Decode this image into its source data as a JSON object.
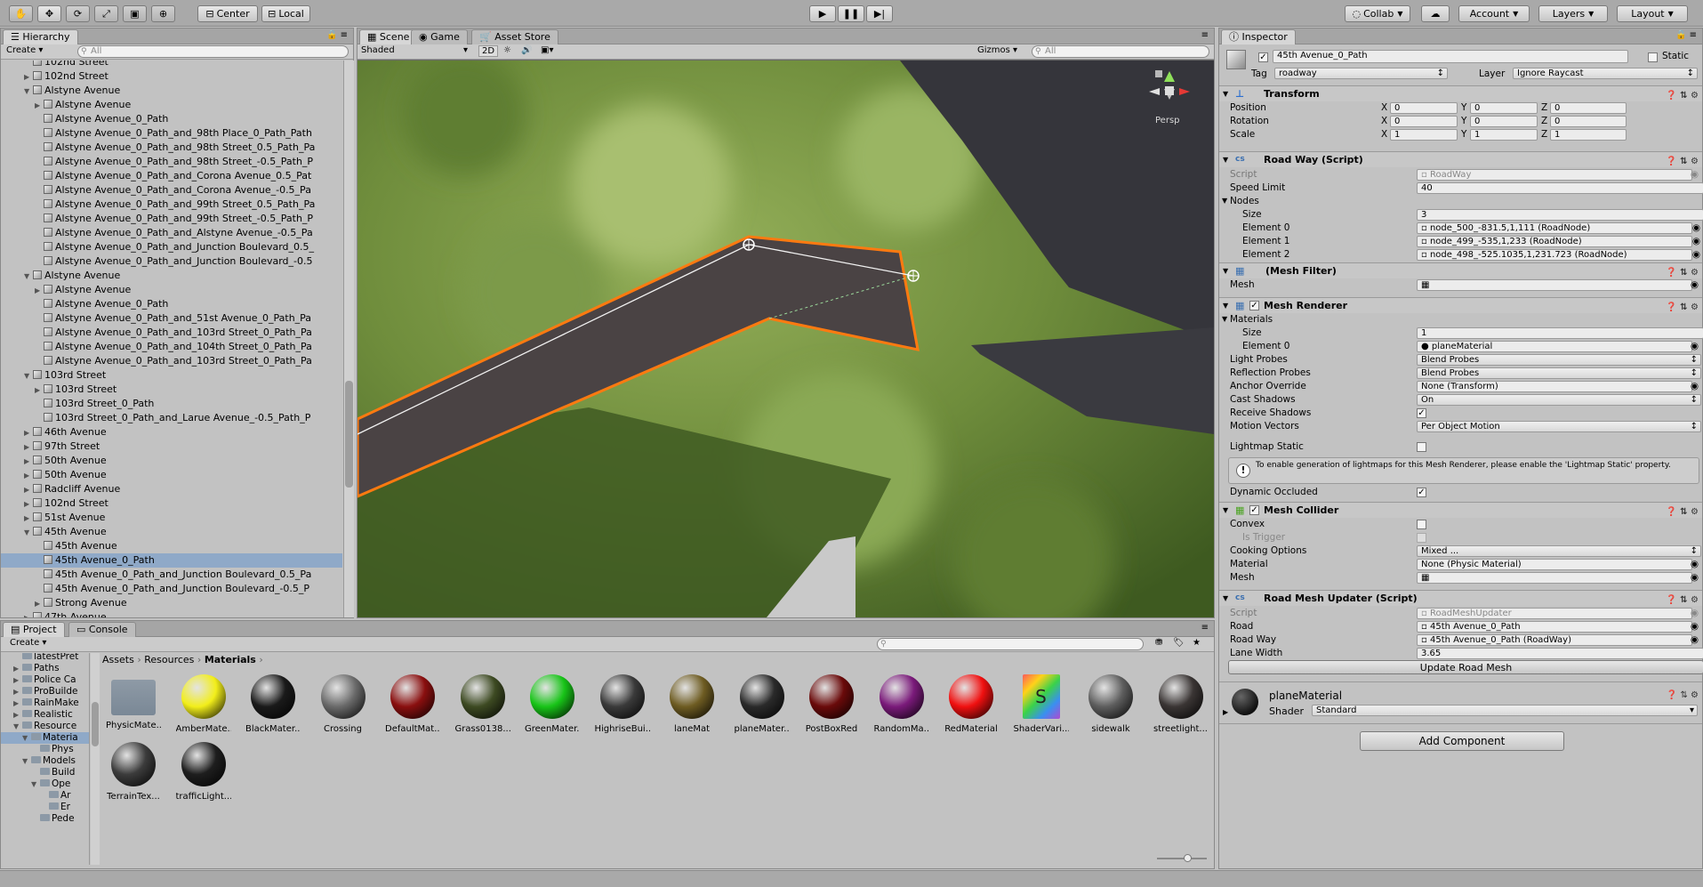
{
  "toolbar": {
    "pivot": "Center",
    "space": "Local",
    "collab": "Collab",
    "account": "Account",
    "layers": "Layers",
    "layout": "Layout"
  },
  "hierarchy": {
    "tab": "Hierarchy",
    "create": "Create",
    "search_placeholder": "All",
    "rows": [
      {
        "label": "102nd Street",
        "indent": 1,
        "arrow": "",
        "icon": true,
        "sel": false
      },
      {
        "label": "102nd Street",
        "indent": 1,
        "arrow": "closed",
        "icon": true,
        "sel": false
      },
      {
        "label": "Alstyne Avenue",
        "indent": 1,
        "arrow": "open",
        "icon": true,
        "sel": false
      },
      {
        "label": "Alstyne Avenue",
        "indent": 2,
        "arrow": "closed",
        "icon": true,
        "sel": false
      },
      {
        "label": "Alstyne Avenue_0_Path",
        "indent": 2,
        "arrow": "",
        "icon": true,
        "sel": false
      },
      {
        "label": "Alstyne Avenue_0_Path_and_98th Place_0_Path_Path",
        "indent": 2,
        "arrow": "",
        "icon": true,
        "sel": false
      },
      {
        "label": "Alstyne Avenue_0_Path_and_98th Street_0.5_Path_Pa",
        "indent": 2,
        "arrow": "",
        "icon": true,
        "sel": false
      },
      {
        "label": "Alstyne Avenue_0_Path_and_98th Street_-0.5_Path_P",
        "indent": 2,
        "arrow": "",
        "icon": true,
        "sel": false
      },
      {
        "label": "Alstyne Avenue_0_Path_and_Corona Avenue_0.5_Pat",
        "indent": 2,
        "arrow": "",
        "icon": true,
        "sel": false
      },
      {
        "label": "Alstyne Avenue_0_Path_and_Corona Avenue_-0.5_Pa",
        "indent": 2,
        "arrow": "",
        "icon": true,
        "sel": false
      },
      {
        "label": "Alstyne Avenue_0_Path_and_99th Street_0.5_Path_Pa",
        "indent": 2,
        "arrow": "",
        "icon": true,
        "sel": false
      },
      {
        "label": "Alstyne Avenue_0_Path_and_99th Street_-0.5_Path_P",
        "indent": 2,
        "arrow": "",
        "icon": true,
        "sel": false
      },
      {
        "label": "Alstyne Avenue_0_Path_and_Alstyne Avenue_-0.5_Pa",
        "indent": 2,
        "arrow": "",
        "icon": true,
        "sel": false
      },
      {
        "label": "Alstyne Avenue_0_Path_and_Junction Boulevard_0.5_",
        "indent": 2,
        "arrow": "",
        "icon": true,
        "sel": false
      },
      {
        "label": "Alstyne Avenue_0_Path_and_Junction Boulevard_-0.5",
        "indent": 2,
        "arrow": "",
        "icon": true,
        "sel": false
      },
      {
        "label": "Alstyne Avenue",
        "indent": 1,
        "arrow": "open",
        "icon": true,
        "sel": false
      },
      {
        "label": "Alstyne Avenue",
        "indent": 2,
        "arrow": "closed",
        "icon": true,
        "sel": false
      },
      {
        "label": "Alstyne Avenue_0_Path",
        "indent": 2,
        "arrow": "",
        "icon": true,
        "sel": false
      },
      {
        "label": "Alstyne Avenue_0_Path_and_51st Avenue_0_Path_Pa",
        "indent": 2,
        "arrow": "",
        "icon": true,
        "sel": false
      },
      {
        "label": "Alstyne Avenue_0_Path_and_103rd Street_0_Path_Pa",
        "indent": 2,
        "arrow": "",
        "icon": true,
        "sel": false
      },
      {
        "label": "Alstyne Avenue_0_Path_and_104th Street_0_Path_Pa",
        "indent": 2,
        "arrow": "",
        "icon": true,
        "sel": false
      },
      {
        "label": "Alstyne Avenue_0_Path_and_103rd Street_0_Path_Pa",
        "indent": 2,
        "arrow": "",
        "icon": true,
        "sel": false
      },
      {
        "label": "103rd Street",
        "indent": 1,
        "arrow": "open",
        "icon": true,
        "sel": false
      },
      {
        "label": "103rd Street",
        "indent": 2,
        "arrow": "closed",
        "icon": true,
        "sel": false
      },
      {
        "label": "103rd Street_0_Path",
        "indent": 2,
        "arrow": "",
        "icon": true,
        "sel": false
      },
      {
        "label": "103rd Street_0_Path_and_Larue Avenue_-0.5_Path_P",
        "indent": 2,
        "arrow": "",
        "icon": true,
        "sel": false
      },
      {
        "label": "46th Avenue",
        "indent": 1,
        "arrow": "closed",
        "icon": true,
        "sel": false
      },
      {
        "label": "97th Street",
        "indent": 1,
        "arrow": "closed",
        "icon": true,
        "sel": false
      },
      {
        "label": "50th Avenue",
        "indent": 1,
        "arrow": "closed",
        "icon": true,
        "sel": false
      },
      {
        "label": "50th Avenue",
        "indent": 1,
        "arrow": "closed",
        "icon": true,
        "sel": false
      },
      {
        "label": "Radcliff Avenue",
        "indent": 1,
        "arrow": "closed",
        "icon": true,
        "sel": false
      },
      {
        "label": "102nd Street",
        "indent": 1,
        "arrow": "closed",
        "icon": true,
        "sel": false
      },
      {
        "label": "51st Avenue",
        "indent": 1,
        "arrow": "closed",
        "icon": true,
        "sel": false
      },
      {
        "label": "45th Avenue",
        "indent": 1,
        "arrow": "open",
        "icon": true,
        "sel": false
      },
      {
        "label": "45th Avenue",
        "indent": 2,
        "arrow": "",
        "icon": true,
        "sel": false
      },
      {
        "label": "45th Avenue_0_Path",
        "indent": 2,
        "arrow": "",
        "icon": true,
        "sel": true
      },
      {
        "label": "45th Avenue_0_Path_and_Junction Boulevard_0.5_Pa",
        "indent": 2,
        "arrow": "",
        "icon": true,
        "sel": false
      },
      {
        "label": "45th Avenue_0_Path_and_Junction Boulevard_-0.5_P",
        "indent": 2,
        "arrow": "",
        "icon": true,
        "sel": false
      },
      {
        "label": "Strong Avenue",
        "indent": 2,
        "arrow": "closed",
        "icon": true,
        "sel": false
      },
      {
        "label": "47th Avenue",
        "indent": 1,
        "arrow": "closed",
        "icon": true,
        "sel": false
      }
    ]
  },
  "scene": {
    "tabs": [
      "Scene",
      "Game",
      "Asset Store"
    ],
    "shading": "Shaded",
    "mode_2d": "2D",
    "gizmos": "Gizmos",
    "search_placeholder": "All",
    "persp": "Persp"
  },
  "project": {
    "tabs": [
      "Project",
      "Console"
    ],
    "create": "Create",
    "breadcrumb": [
      "Assets",
      "Resources",
      "Materials"
    ],
    "tree": [
      {
        "label": "latestPret",
        "indent": 1,
        "arrow": ""
      },
      {
        "label": "Paths",
        "indent": 1,
        "arrow": "closed"
      },
      {
        "label": "Police Ca",
        "indent": 1,
        "arrow": "closed"
      },
      {
        "label": "ProBuilde",
        "indent": 1,
        "arrow": "closed"
      },
      {
        "label": "RainMake",
        "indent": 1,
        "arrow": "closed"
      },
      {
        "label": "Realistic",
        "indent": 1,
        "arrow": "closed"
      },
      {
        "label": "Resource",
        "indent": 1,
        "arrow": "open"
      },
      {
        "label": "Materia",
        "indent": 2,
        "arrow": "open"
      },
      {
        "label": "Phys",
        "indent": 3,
        "arrow": ""
      },
      {
        "label": "Models",
        "indent": 2,
        "arrow": "open"
      },
      {
        "label": "Build",
        "indent": 3,
        "arrow": ""
      },
      {
        "label": "Ope",
        "indent": 3,
        "arrow": "open"
      },
      {
        "label": "Ar",
        "indent": 4,
        "arrow": ""
      },
      {
        "label": "Er",
        "indent": 4,
        "arrow": ""
      },
      {
        "label": "Pede",
        "indent": 3,
        "arrow": ""
      }
    ],
    "materials": [
      {
        "label": "PhysicMate...",
        "kind": "folder",
        "color": "#7a8896"
      },
      {
        "label": "AmberMate...",
        "kind": "sphere",
        "color": "#f2ee1a"
      },
      {
        "label": "BlackMater...",
        "kind": "sphere",
        "color": "#1a1a1a"
      },
      {
        "label": "Crossing",
        "kind": "sphere",
        "color": "#6a6a6a"
      },
      {
        "label": "DefaultMat...",
        "kind": "sphere",
        "color": "#8a0f0f"
      },
      {
        "label": "Grass0138...",
        "kind": "sphere",
        "color": "#3d4a22"
      },
      {
        "label": "GreenMater...",
        "kind": "sphere",
        "color": "#18c418"
      },
      {
        "label": "HighriseBui...",
        "kind": "sphere",
        "color": "#3a3a3a"
      },
      {
        "label": "laneMat",
        "kind": "sphere",
        "color": "#6e5c22"
      },
      {
        "label": "planeMater...",
        "kind": "sphere",
        "color": "#2a2a2a"
      },
      {
        "label": "PostBoxRed",
        "kind": "sphere",
        "color": "#6a0a0a"
      },
      {
        "label": "RandomMa...",
        "kind": "sphere",
        "color": "#7a1a7a"
      },
      {
        "label": "RedMaterial",
        "kind": "sphere",
        "color": "#f01010"
      },
      {
        "label": "ShaderVari...",
        "kind": "shader",
        "color": "#f0d020"
      },
      {
        "label": "sidewalk",
        "kind": "sphere",
        "color": "#5e5e5e"
      },
      {
        "label": "streetlight...",
        "kind": "sphere",
        "color": "#3a3534"
      },
      {
        "label": "TerrainTex...",
        "kind": "sphere",
        "color": "#3c3c3c"
      },
      {
        "label": "trafficLight...",
        "kind": "sphere",
        "color": "#1e1e1e"
      }
    ]
  },
  "inspector": {
    "tab": "Inspector",
    "object_name": "45th Avenue_0_Path",
    "static_label": "Static",
    "tag_label": "Tag",
    "tag_value": "roadway",
    "layer_label": "Layer",
    "layer_value": "Ignore Raycast",
    "transform": {
      "title": "Transform",
      "rows": [
        {
          "label": "Position",
          "x": "0",
          "y": "0",
          "z": "0"
        },
        {
          "label": "Rotation",
          "x": "0",
          "y": "0",
          "z": "0"
        },
        {
          "label": "Scale",
          "x": "1",
          "y": "1",
          "z": "1"
        }
      ]
    },
    "roadway": {
      "title": "Road Way (Script)",
      "script_label": "Script",
      "script_value": "RoadWay",
      "speed_label": "Speed Limit",
      "speed_value": "40",
      "nodes_label": "Nodes",
      "size_label": "Size",
      "size_value": "3",
      "elements": [
        {
          "label": "Element 0",
          "value": "node_500_-831.5,1,111 (RoadNode)"
        },
        {
          "label": "Element 1",
          "value": "node_499_-535,1,233 (RoadNode)"
        },
        {
          "label": "Element 2",
          "value": "node_498_-525.1035,1,231.723 (RoadNode)"
        }
      ]
    },
    "meshfilter": {
      "title": "(Mesh Filter)",
      "mesh_label": "Mesh",
      "mesh_value": ""
    },
    "meshrenderer": {
      "title": "Mesh Renderer",
      "materials_label": "Materials",
      "size_label": "Size",
      "size_value": "1",
      "element0_label": "Element 0",
      "element0_value": "planeMaterial",
      "light_probes_label": "Light Probes",
      "light_probes_value": "Blend Probes",
      "reflection_label": "Reflection Probes",
      "reflection_value": "Blend Probes",
      "anchor_label": "Anchor Override",
      "anchor_value": "None (Transform)",
      "cast_label": "Cast Shadows",
      "cast_value": "On",
      "receive_label": "Receive Shadows",
      "motion_label": "Motion Vectors",
      "motion_value": "Per Object Motion",
      "lightmap_label": "Lightmap Static",
      "info": "To enable generation of lightmaps for this Mesh Renderer, please enable the 'Lightmap Static' property.",
      "dynamic_label": "Dynamic Occluded"
    },
    "meshcollider": {
      "title": "Mesh Collider",
      "convex_label": "Convex",
      "trigger_label": "Is Trigger",
      "cooking_label": "Cooking Options",
      "cooking_value": "Mixed ...",
      "material_label": "Material",
      "material_value": "None (Physic Material)",
      "mesh_label": "Mesh",
      "mesh_value": ""
    },
    "roadmeshupdater": {
      "title": "Road Mesh Updater (Script)",
      "script_label": "Script",
      "script_value": "RoadMeshUpdater",
      "road_label": "Road",
      "road_value": "45th Avenue_0_Path",
      "roadway_label": "Road Way",
      "roadway_value": "45th Avenue_0_Path (RoadWay)",
      "lane_label": "Lane Width",
      "lane_value": "3.65",
      "update_button": "Update Road Mesh"
    },
    "material": {
      "name": "planeMaterial",
      "shader_label": "Shader",
      "shader_value": "Standard"
    },
    "add_component": "Add Component"
  }
}
